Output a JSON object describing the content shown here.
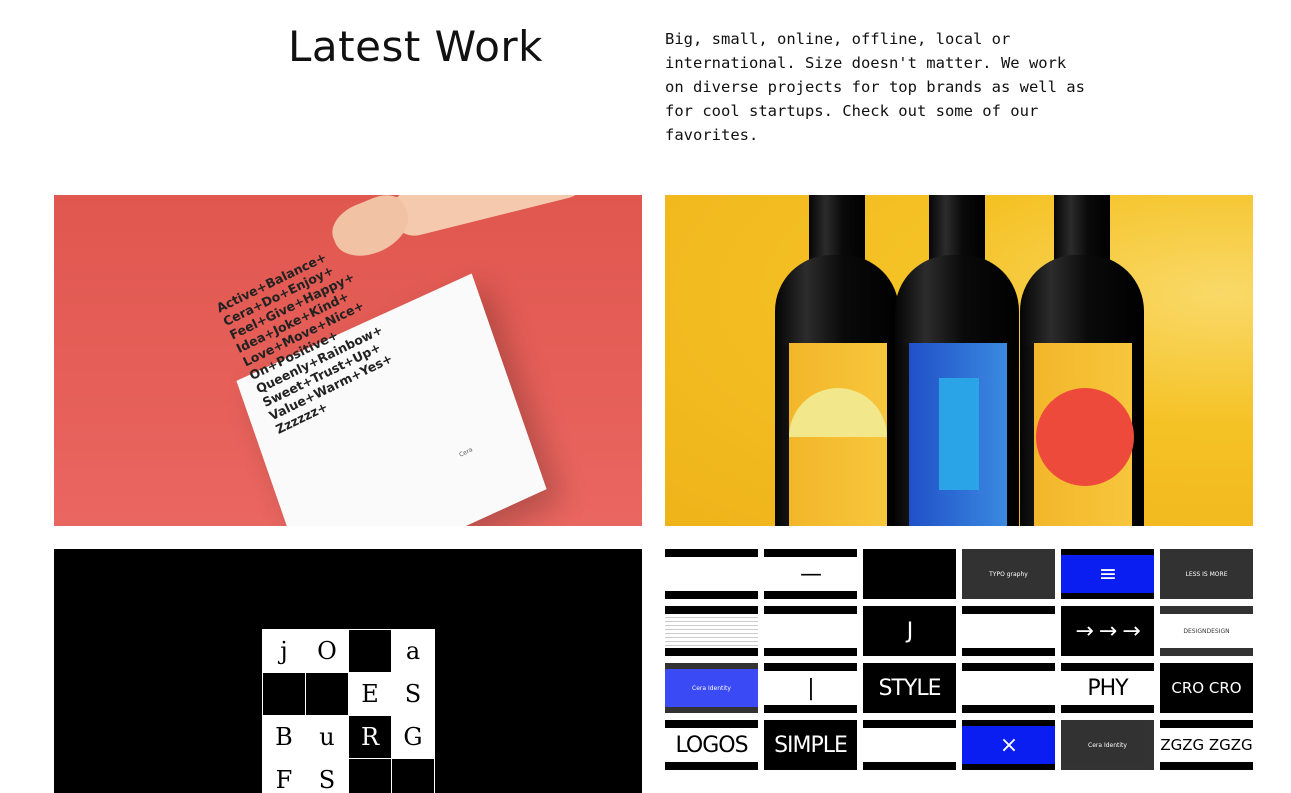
{
  "section": {
    "title": "Latest Work",
    "intro": "Big, small, online, offline, local or international. Size doesn't matter. We work on diverse projects for top brands as well as for cool startups. Check out some of our favorites."
  },
  "projects": {
    "cera": {
      "poster_lines": [
        "Active+Balance+",
        "Cera+Do+Enjoy+",
        "Feel+Give+Happy+",
        "Idea+Joke+Kind+",
        "Love+Move+Nice+",
        "On+Positive+",
        "Queenly+Rainbow+",
        "Sweet+Trust+Up+",
        "Value+Warm+Yes+",
        "Zzzzzz+"
      ],
      "mark": "Cera"
    },
    "specimen": {
      "glyphs": [
        "j",
        "O",
        "",
        "a",
        "",
        "",
        "E",
        "S",
        "B",
        "u",
        "R",
        "G",
        "F",
        "S",
        "",
        ""
      ]
    },
    "thumbnails": [
      {
        "style": "w",
        "text": ""
      },
      {
        "style": "w",
        "text": "—"
      },
      {
        "style": "dark",
        "text": ""
      },
      {
        "style": "dark",
        "text": "TYPO graphy"
      },
      {
        "style": "blue",
        "text": "≡"
      },
      {
        "style": "dark",
        "text": "LESS IS MORE"
      },
      {
        "style": "lines",
        "text": ""
      },
      {
        "style": "w",
        "text": ""
      },
      {
        "style": "dark",
        "text": "J"
      },
      {
        "style": "w",
        "text": ""
      },
      {
        "style": "dark",
        "text": "→ → →"
      },
      {
        "style": "w",
        "text": "DESIGNDESIGN"
      },
      {
        "style": "blue",
        "text": "Cera Identity"
      },
      {
        "style": "w",
        "text": "|"
      },
      {
        "style": "dark",
        "text": "STYLE"
      },
      {
        "style": "w",
        "text": ""
      },
      {
        "style": "w",
        "text": "PHY"
      },
      {
        "style": "dark",
        "text": "CRO CRO"
      },
      {
        "style": "w",
        "text": "LOGOS"
      },
      {
        "style": "dark",
        "text": "SIMPLE"
      },
      {
        "style": "w",
        "text": ""
      },
      {
        "style": "blue",
        "text": "×"
      },
      {
        "style": "dark",
        "text": "Cera Identity"
      },
      {
        "style": "w",
        "text": "ZGZG ZGZG"
      }
    ]
  }
}
